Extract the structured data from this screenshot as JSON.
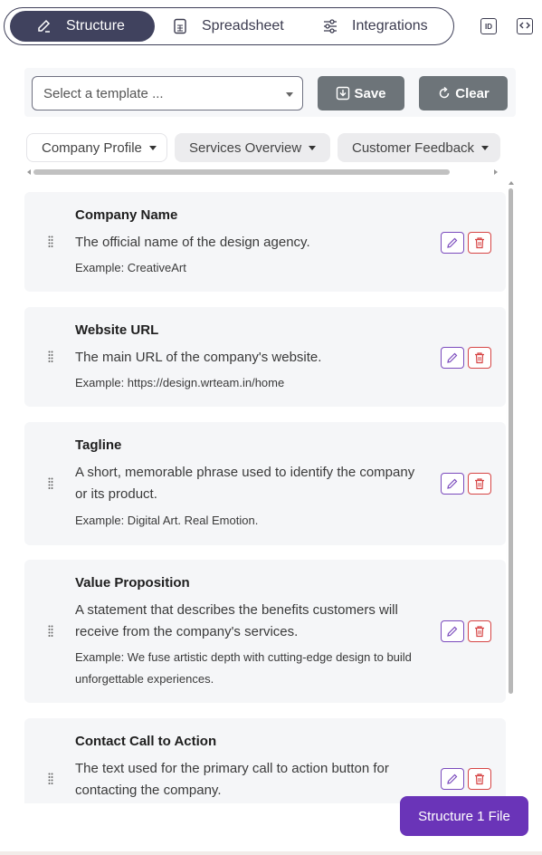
{
  "tabs": [
    {
      "label": "Structure",
      "icon": "pencil-square-icon",
      "active": true
    },
    {
      "label": "Spreadsheet",
      "icon": "spreadsheet-icon",
      "active": false
    },
    {
      "label": "Integrations",
      "icon": "sliders-icon",
      "active": false
    }
  ],
  "toolbar_icons": {
    "id_label": "ID",
    "code_icon": "code-icon"
  },
  "template": {
    "placeholder": "Select a template ...",
    "save_label": "Save",
    "clear_label": "Clear"
  },
  "sections": [
    {
      "label": "Company Profile",
      "active": true
    },
    {
      "label": "Services Overview",
      "active": false
    },
    {
      "label": "Customer Feedback",
      "active": false
    }
  ],
  "fields": [
    {
      "title": "Company Name",
      "desc": "The official name of the design agency.",
      "example": "Example: CreativeArt"
    },
    {
      "title": "Website URL",
      "desc": "The main URL of the company's website.",
      "example": "Example: https://design.wrteam.in/home"
    },
    {
      "title": "Tagline",
      "desc": "A short, memorable phrase used to identify the company or its product.",
      "example": "Example: Digital Art. Real Emotion."
    },
    {
      "title": "Value Proposition",
      "desc": "A statement that describes the benefits customers will receive from the company's services.",
      "example": "Example: We fuse artistic depth with cutting-edge design to build unforgettable experiences."
    },
    {
      "title": "Contact Call to Action",
      "desc": "The text used for the primary call to action button for contacting the company.",
      "example": ""
    }
  ],
  "cta_label": "Structure 1 File",
  "colors": {
    "accent": "#6a34b8",
    "tab_active": "#40425e",
    "edit": "#7b4bbd",
    "delete": "#d64545",
    "action_button": "#6d7479"
  }
}
